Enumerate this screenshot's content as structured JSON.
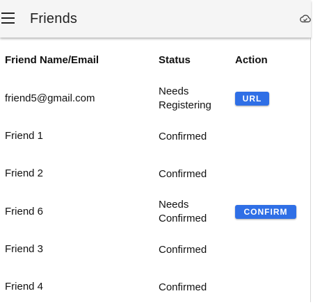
{
  "appbar": {
    "menu_icon": "hamburger-menu-icon",
    "title": "Friends",
    "cloud_icon": "cloud-sync-icon"
  },
  "table": {
    "headers": {
      "name": "Friend Name/Email",
      "status": "Status",
      "action": "Action"
    },
    "rows": [
      {
        "name": "friend5@gmail.com",
        "status_line1": "Needs",
        "status_line2": "Registering",
        "action": "URL"
      },
      {
        "name": "Friend 1",
        "status_line1": "Confirmed",
        "status_line2": "",
        "action": ""
      },
      {
        "name": "Friend 2",
        "status_line1": "Confirmed",
        "status_line2": "",
        "action": ""
      },
      {
        "name": "Friend 6",
        "status_line1": "Needs",
        "status_line2": "Confirmed",
        "action": "CONFIRM"
      },
      {
        "name": "Friend 3",
        "status_line1": "Confirmed",
        "status_line2": "",
        "action": ""
      },
      {
        "name": "Friend 4",
        "status_line1": "Confirmed",
        "status_line2": "",
        "action": ""
      }
    ]
  },
  "colors": {
    "appbar_bg": "#f5f5f5",
    "button_bg": "#2f6fe6",
    "button_text": "#ffffff"
  }
}
